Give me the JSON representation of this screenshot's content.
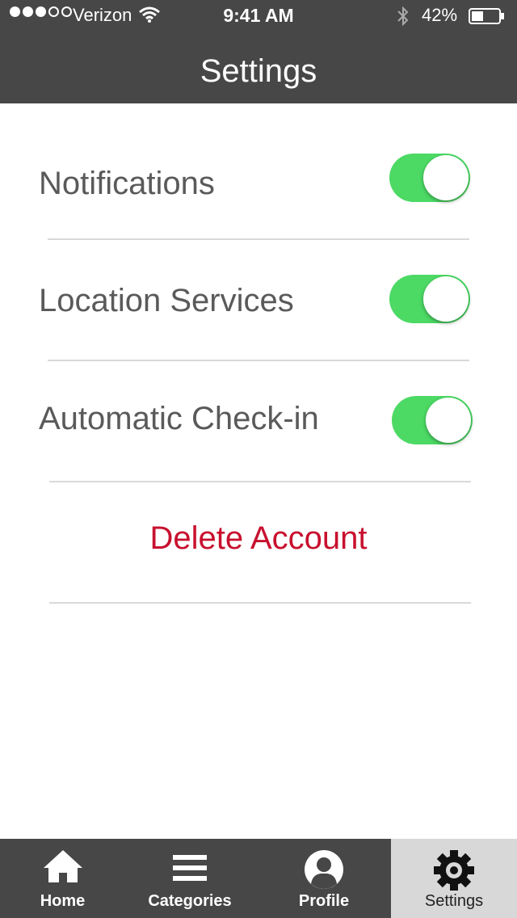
{
  "status_bar": {
    "carrier": "Verizon",
    "time": "9:41 AM",
    "battery_percent": "42%",
    "signal_strength": 3,
    "signal_total": 5
  },
  "header": {
    "title": "Settings"
  },
  "settings": {
    "notifications": {
      "label": "Notifications",
      "enabled": true
    },
    "location_services": {
      "label": "Location Services",
      "enabled": true
    },
    "automatic_checkin": {
      "label": "Automatic Check-in",
      "enabled": true
    },
    "delete_account_label": "Delete Account"
  },
  "tabbar": {
    "tabs": [
      {
        "label": "Home",
        "icon": "home-icon",
        "active": false
      },
      {
        "label": "Categories",
        "icon": "menu-icon",
        "active": false
      },
      {
        "label": "Profile",
        "icon": "profile-icon",
        "active": false
      },
      {
        "label": "Settings",
        "icon": "gear-icon",
        "active": true
      }
    ]
  },
  "colors": {
    "header_bg": "#474747",
    "toggle_on": "#4cd964",
    "destructive": "#c8102e",
    "active_tab_bg": "#d8d8d8"
  }
}
